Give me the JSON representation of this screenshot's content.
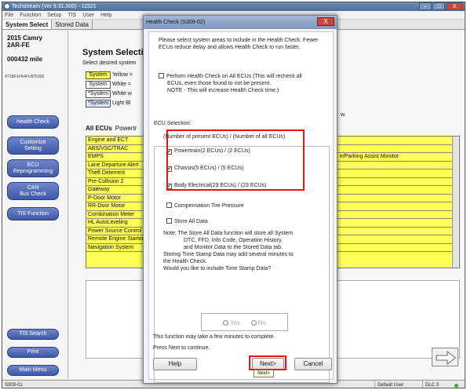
{
  "window": {
    "title": "Techstream (Ver 9.31.000) - 11521",
    "minimize": "–",
    "maximize": "□",
    "close": "X"
  },
  "menu": [
    "File",
    "Function",
    "Setup",
    "TIS",
    "User",
    "Help"
  ],
  "tabs": [
    "System Select",
    "Stored Data"
  ],
  "vehicle": {
    "model": "2015 Camry",
    "engine": "2AR-FE",
    "mileage": "000432 mile",
    "vin": "4T1BF1FK4FU875326"
  },
  "sidebar": {
    "health_check": "Health Check",
    "customize_line1": "Customize",
    "customize_line2": "Setting",
    "ecu_line1": "ECU",
    "ecu_line2": "Reprogramming",
    "can_line1": "CAN",
    "can_line2": "Bus Check",
    "tis_function": "TIS Function",
    "tis_search": "TIS Search",
    "print": "Print",
    "main_menu": "Main Menu"
  },
  "main": {
    "heading": "System Selecti",
    "subheading": "Select desired system",
    "legend": [
      {
        "box": "System",
        "text": "Yellow ="
      },
      {
        "box": "System",
        "text": "White ="
      },
      {
        "box": "*System",
        "text": "White w"
      },
      {
        "box": "*System",
        "text": "Light Bl"
      }
    ],
    "trailing_w": "w.",
    "ecu_tabs": [
      "All ECUs",
      "Powertr"
    ],
    "ecu_rows": [
      {
        "name": "Engine and ECT",
        "col2": ""
      },
      {
        "name": "ABS/VSC/TRAC",
        "col2": ""
      },
      {
        "name": "EMPS",
        "col2": "e/Parking Assist Monitor"
      },
      {
        "name": "Lane Departure Alert",
        "col2": ""
      },
      {
        "name": "Theft Deterrent",
        "col2": ""
      },
      {
        "name": "Pre-Collision 2",
        "col2": ""
      },
      {
        "name": "Gateway",
        "col2": ""
      },
      {
        "name": "P-Door Motor",
        "col2": ""
      },
      {
        "name": "RR-Door Motor",
        "col2": ""
      },
      {
        "name": "Combination Meter",
        "col2": ""
      },
      {
        "name": "HL AutoLeveling",
        "col2": ""
      },
      {
        "name": "Power Source Control",
        "col2": ""
      },
      {
        "name": "Remote Engine Starter",
        "col2": ""
      },
      {
        "name": "Navigation System",
        "col2": ""
      }
    ]
  },
  "statusbar": {
    "code": "S303-01",
    "user": "Default User",
    "dlc": "DLC 3"
  },
  "dialog": {
    "title": "Health Check (S309-02)",
    "close": "X",
    "intro": "Please select system areas to include in the Health Check. Fewer ECUs reduce delay and allows Health Check to run faster.",
    "perform_all_line1": "Perform Health Check on All ECUs (This will recheck all",
    "perform_all_line2": "ECUs, even those found to not be present.",
    "perform_all_line3": "NOTE - This will increase Health Check time.)",
    "ecu_selection": "ECU Selection:",
    "count_header": "(Number of present ECUs) / (Number of all ECUs)",
    "powertrain": "Powertrain(2 ECUs) / (2 ECUs)",
    "chassis": "Chassis(5 ECUs) / (5 ECUs)",
    "body": "Body Electrical(23 ECUs) / (23 ECUs)",
    "tire": "Compensation Tire Pressure",
    "store_all": "Store All Data",
    "note_line1": "Note: The Store All Data function will store all System",
    "note_line2": "DTC, FFD, Info Code, Operation History,",
    "note_line3": "and Monitor Data to the Stored Data tab.",
    "timestamp_line1": "Storing Time Stamp Data may add several minutes to",
    "timestamp_line2": "the Health Check.",
    "timestamp_line3": "Would you like to include Time Stamp Data?",
    "yes": "Yes",
    "no": "No",
    "takes_time": "This function may take a few minutes to complete.",
    "press_next": "Press Next to continue.",
    "help": "Help",
    "next": "Next>",
    "cancel": "Cancel",
    "tooltip": "Next>"
  }
}
